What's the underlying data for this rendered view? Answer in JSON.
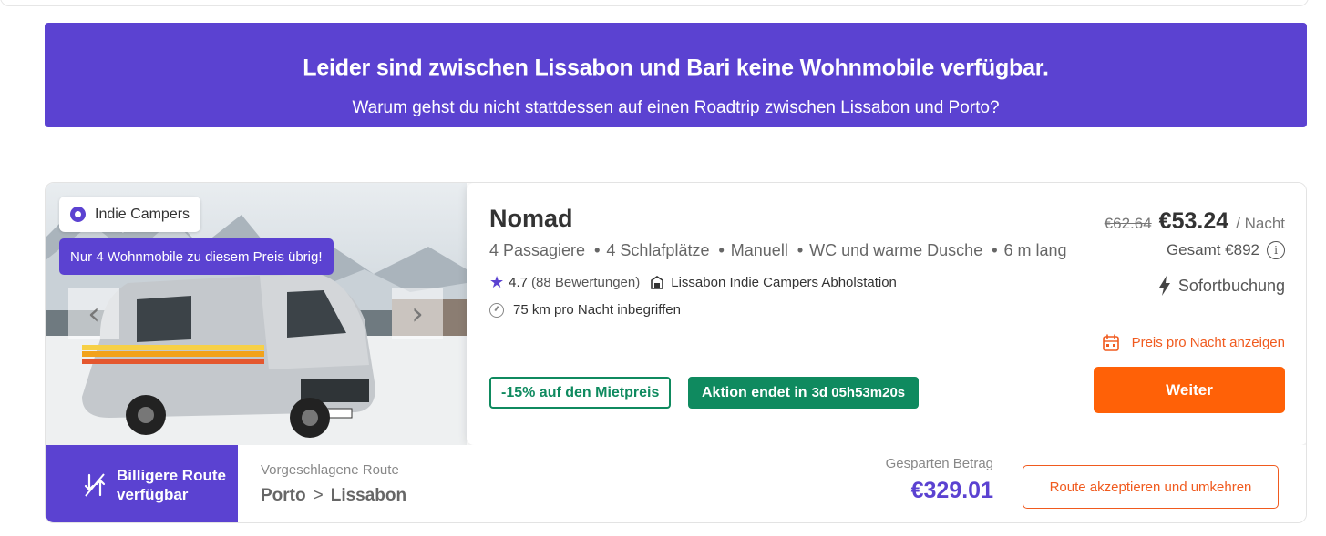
{
  "banner": {
    "title": "Leider sind zwischen Lissabon und Bari keine Wohnmobile verfügbar.",
    "subtitle": "Warum gehst du nicht stattdessen auf einen Roadtrip zwischen Lissabon und Porto?"
  },
  "listing": {
    "image": {
      "brand_icon": "brand-circle-icon",
      "brand": "Indie Campers",
      "scarcity": "Nur 4 Wohnmobile zu diesem Preis übrig!",
      "prev_icon": "chevron-left-icon",
      "next_icon": "chevron-right-icon"
    },
    "name": "Nomad",
    "specs": [
      "4 Passagiere",
      "4 Schlafplätze",
      "Manuell",
      "WC und warme Dusche",
      "6 m lang"
    ],
    "rating": "4.7",
    "reviews": "(88 Bewertungen)",
    "station": "Lissabon Indie Campers Abholstation",
    "km_included": "75 km pro Nacht inbegriffen",
    "discount_badge": "-15% auf den Mietpreis",
    "promo_label": "Aktion endet in",
    "promo_countdown": "3d 05h53m20s",
    "old_price": "€62.64",
    "price": "€53.24",
    "per_night": "/ Nacht",
    "total": "Gesamt €892",
    "instant_booking": "Sofortbuchung",
    "nightly_link": "Preis pro Nacht anzeigen",
    "cta": "Weiter"
  },
  "route": {
    "cheaper_label": "Billigere Route verfügbar",
    "suggested_label": "Vorgeschlagene Route",
    "from": "Porto",
    "arrow": ">",
    "to": "Lissabon",
    "saved_label": "Gesparten Betrag",
    "saved_amount": "€329.01",
    "accept_button": "Route akzeptieren und umkehren"
  },
  "colors": {
    "brand": "#5b42d1",
    "cta": "#ff6107",
    "promo": "#0f8a5f",
    "link": "#f05a1e"
  }
}
